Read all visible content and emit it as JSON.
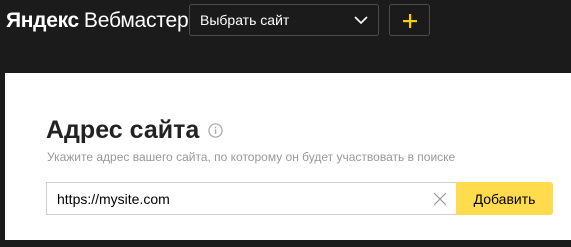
{
  "header": {
    "logo_brand": "Яндекс",
    "logo_product": "Вебмастер",
    "site_select_value": "Выбрать сайт",
    "add_site_icon": "plus-icon",
    "chevron_icon": "chevron-down-icon"
  },
  "form": {
    "title": "Адрес сайта",
    "info_icon": "info-icon",
    "hint": "Укажите адрес вашего сайта, по которому он будет участвовать в поиске",
    "url_value": "https://mysite.com",
    "clear_icon": "close-icon",
    "submit_label": "Добавить"
  },
  "colors": {
    "header_bg": "#1b1b1b",
    "accent_yellow": "#ffdb4d",
    "plus_yellow": "#ffcc00",
    "hint_gray": "#999999"
  }
}
